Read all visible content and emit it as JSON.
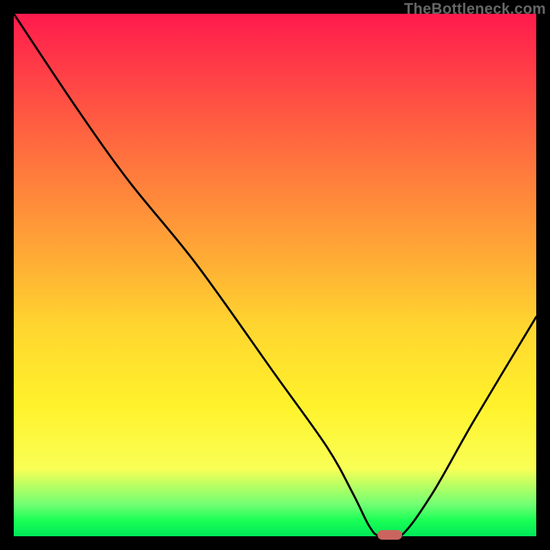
{
  "watermark": "TheBottleneck.com",
  "colors": {
    "curve_stroke": "#000000",
    "marker_fill": "#c9655e",
    "frame_bg": "#000000"
  },
  "chart_data": {
    "type": "line",
    "title": "",
    "xlabel": "",
    "ylabel": "",
    "xlim": [
      0,
      100
    ],
    "ylim": [
      0,
      100
    ],
    "grid": false,
    "legend": false,
    "series": [
      {
        "name": "bottleneck-curve",
        "x": [
          0,
          12,
          22,
          35,
          50,
          60,
          65,
          68,
          70,
          74,
          80,
          88,
          100
        ],
        "values": [
          100,
          82,
          68,
          52,
          31,
          17,
          8,
          2,
          0,
          0,
          8,
          22,
          42
        ]
      }
    ],
    "marker": {
      "x": 72,
      "y": 0
    }
  }
}
